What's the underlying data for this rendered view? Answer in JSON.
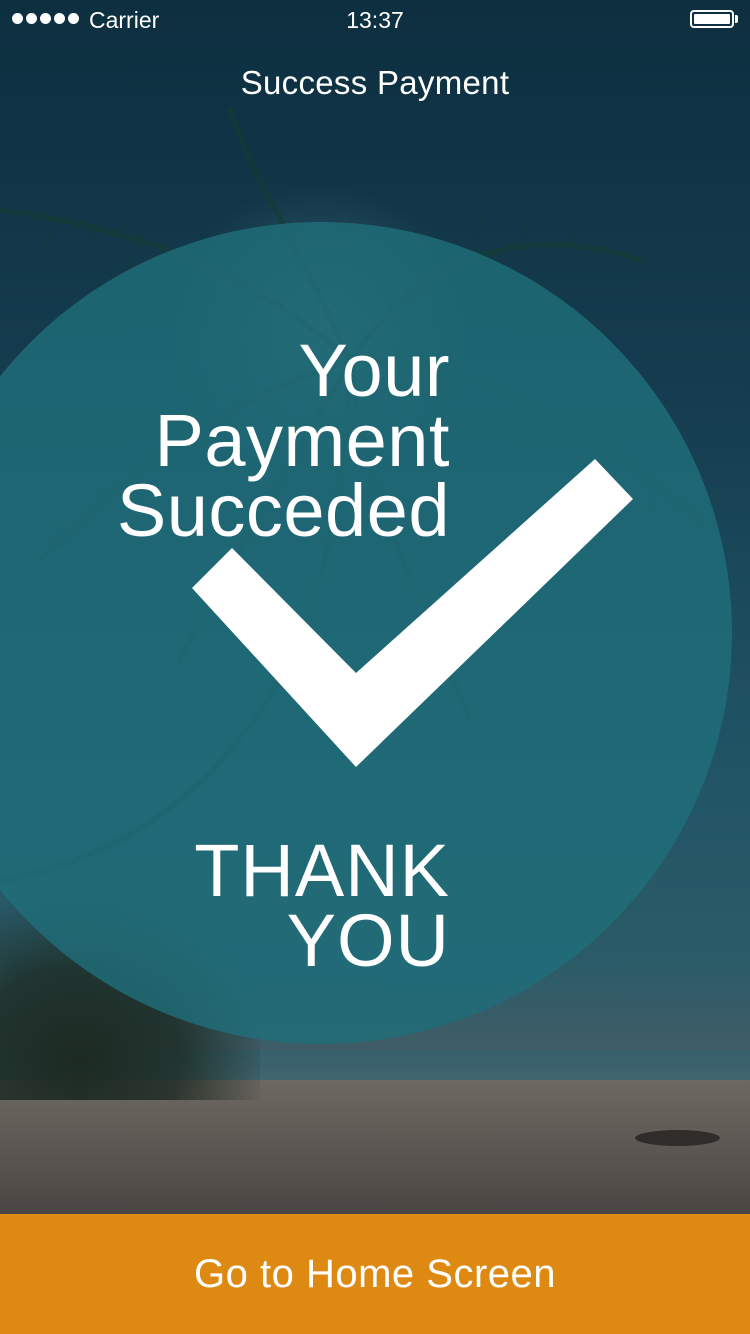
{
  "status_bar": {
    "carrier": "Carrier",
    "time": "13:37",
    "signal_icon": "signal-dots-icon",
    "battery_icon": "battery-icon"
  },
  "nav": {
    "title": "Success Payment"
  },
  "message": {
    "line1": "Your",
    "line2": "Payment",
    "line3": "Succeded",
    "check_icon": "checkmark-icon",
    "thanks_line1": "THANK",
    "thanks_line2": "YOU"
  },
  "actions": {
    "home_button_label": "Go to Home Screen"
  },
  "colors": {
    "circle": "#206e7a",
    "button": "#de8a12",
    "text": "#ffffff"
  }
}
